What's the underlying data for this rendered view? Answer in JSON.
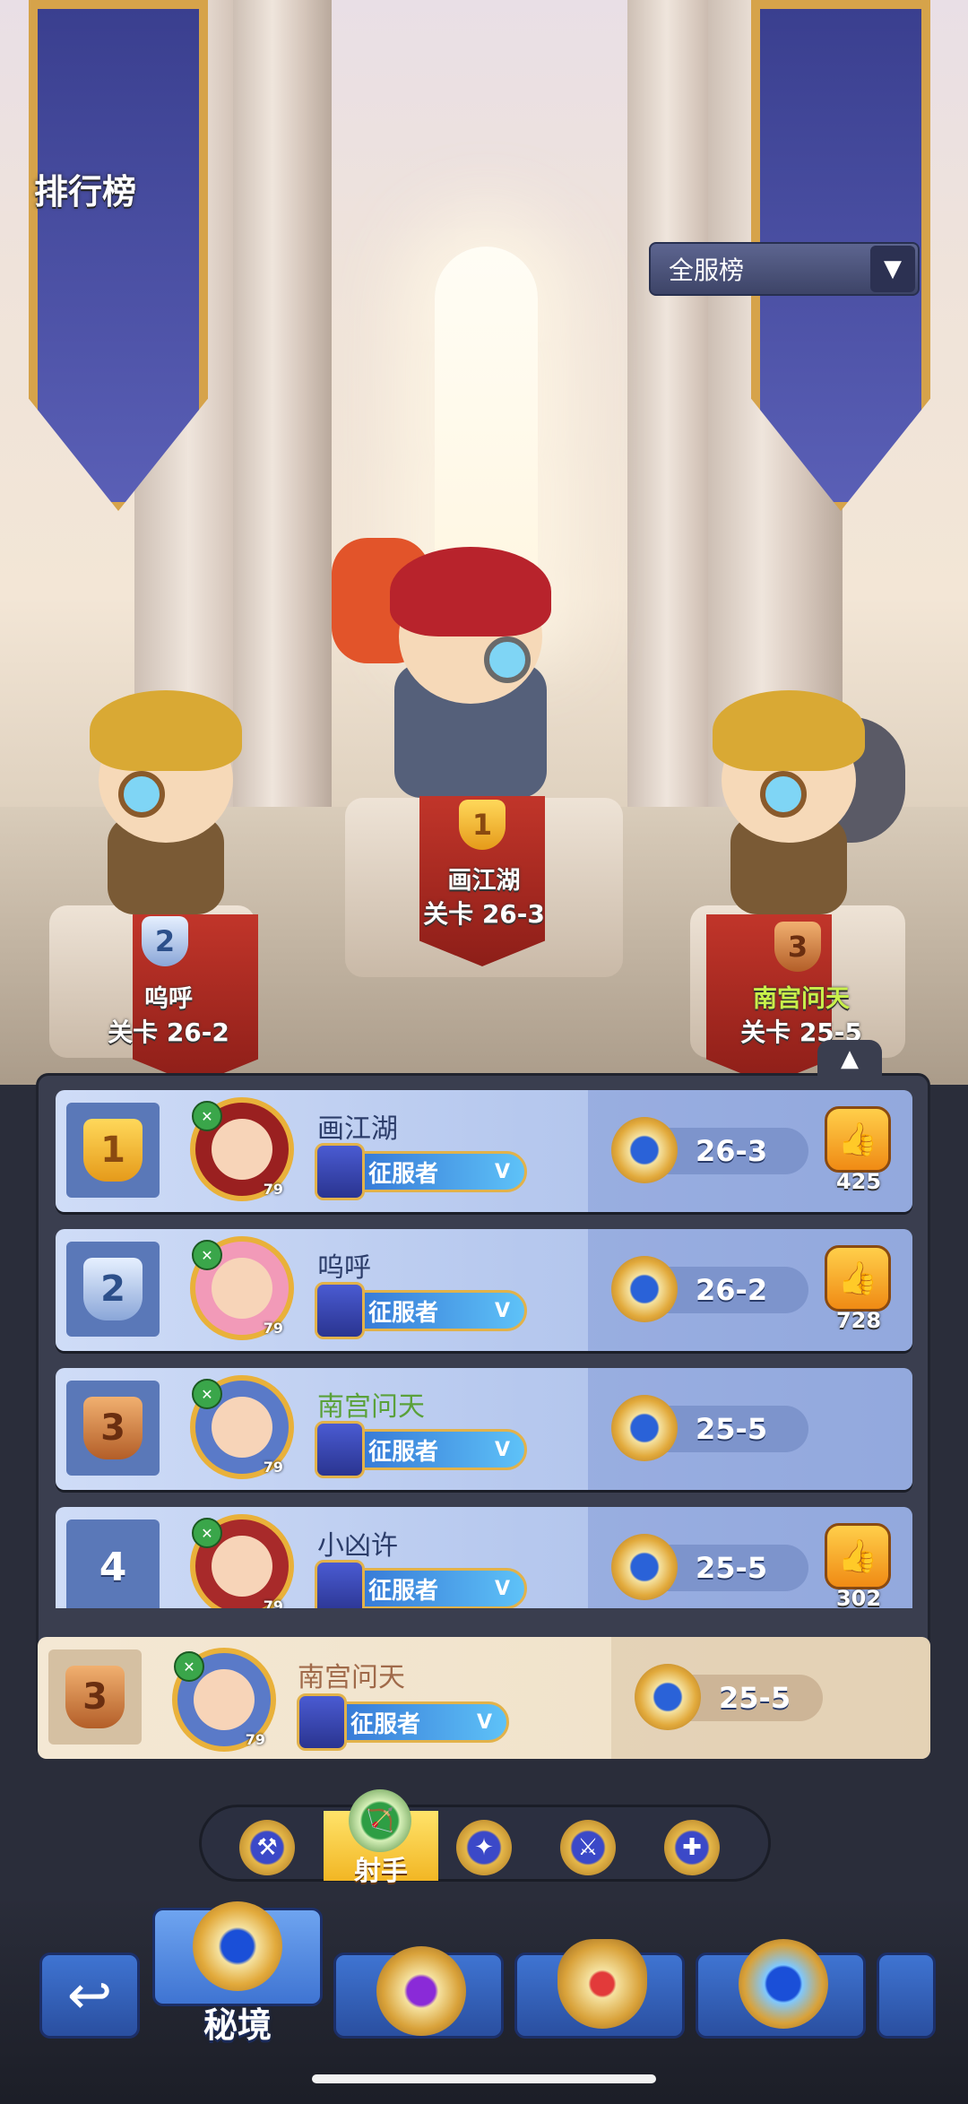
{
  "page_title": "排行榜",
  "server_dropdown": {
    "selected": "全服榜",
    "arrow": "▼"
  },
  "podium": [
    {
      "rank": "1",
      "name": "画江湖",
      "stage": "关卡 26-3"
    },
    {
      "rank": "2",
      "name": "呜呼",
      "stage": "关卡 26-2"
    },
    {
      "rank": "3",
      "name": "南宫问天",
      "stage": "关卡 25-5",
      "name_color": "#c8f04a"
    }
  ],
  "collapse_arrow": "▲",
  "rows": [
    {
      "rank": "1",
      "name": "画江湖",
      "level": "79",
      "title": "征服者",
      "title_tag": "V",
      "stage": "26-3",
      "likes": "425",
      "thumb": "👍"
    },
    {
      "rank": "2",
      "name": "呜呼",
      "level": "79",
      "title": "征服者",
      "title_tag": "V",
      "stage": "26-2",
      "likes": "728",
      "thumb": "👍"
    },
    {
      "rank": "3",
      "name": "南宫问天",
      "level": "79",
      "title": "征服者",
      "title_tag": "V",
      "stage": "25-5"
    },
    {
      "rank": "4",
      "name": "小凶许",
      "level": "79",
      "title": "征服者",
      "title_tag": "V",
      "stage": "25-5",
      "likes": "302",
      "thumb": "👍"
    }
  ],
  "my_row": {
    "rank": "3",
    "name": "南宫问天",
    "level": "79",
    "title": "征服者",
    "title_tag": "V",
    "stage": "25-5"
  },
  "class_tabs": [
    {
      "icon": "axe-icon",
      "glyph": "⚒"
    },
    {
      "icon": "bow-icon",
      "glyph": "🏹",
      "label": "射手",
      "selected": true
    },
    {
      "icon": "staff-icon",
      "glyph": "✦"
    },
    {
      "icon": "dagger-icon",
      "glyph": "⚔"
    },
    {
      "icon": "cross-icon",
      "glyph": "✚"
    }
  ],
  "bottom_nav": {
    "back_glyph": "↩",
    "selected_label": "秘境"
  },
  "colors": {
    "gold": "#e9b13a",
    "row_blue": "#b6c8ee",
    "my_row": "#f4e8d4",
    "green_name": "#5aa13a"
  }
}
